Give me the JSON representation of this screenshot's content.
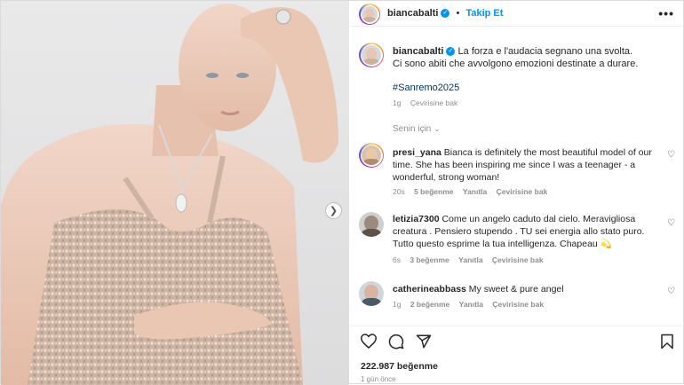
{
  "header": {
    "username": "biancabalti",
    "separator": "•",
    "follow_label": "Takip Et",
    "more_label": "•••"
  },
  "caption": {
    "username": "biancabalti",
    "text_line1": "La forza e l'audacia segnano una svolta.",
    "text_line2": "Ci sono abiti che avvolgono emozioni destinate a durare.",
    "hashtag": "#Sanremo2025",
    "time": "1g",
    "translate": "Çevirisine bak"
  },
  "section_label": "Senin için",
  "comments": [
    {
      "username": "presi_yana",
      "text": "Bianca is definitely the most beautiful model of our time. She has been inspiring me since I was a teenager - a wonderful, strong woman!",
      "time": "20s",
      "likes": "5 beğenme",
      "reply": "Yanıtla",
      "translate": "Çevirisine bak"
    },
    {
      "username": "letizia7300",
      "text": "Come un angelo caduto dal cielo. Meravigliosa creatura . Pensiero stupendo . TU sei energia allo stato puro. Tutto questo esprime la tua intelligenza. Chapeau 💫",
      "time": "6s",
      "likes": "3 beğenme",
      "reply": "Yanıtla",
      "translate": "Çevirisine bak"
    },
    {
      "username": "catherineabbass",
      "text": "My sweet & pure angel",
      "time": "1g",
      "likes": "2 beğenme",
      "reply": "Yanıtla",
      "translate": "Çevirisine bak"
    }
  ],
  "footer": {
    "likes": "222.987 beğenme",
    "ago": "1 gün önce"
  },
  "colors": {
    "accent": "#0095f6",
    "hashtag": "#00376b",
    "muted": "#8e8e8e",
    "text": "#262626"
  },
  "icons": {
    "next": "chevron-right-icon",
    "like": "heart-icon",
    "comment": "comment-icon",
    "share": "paper-plane-icon",
    "save": "bookmark-icon",
    "verified": "verified-badge-icon"
  }
}
